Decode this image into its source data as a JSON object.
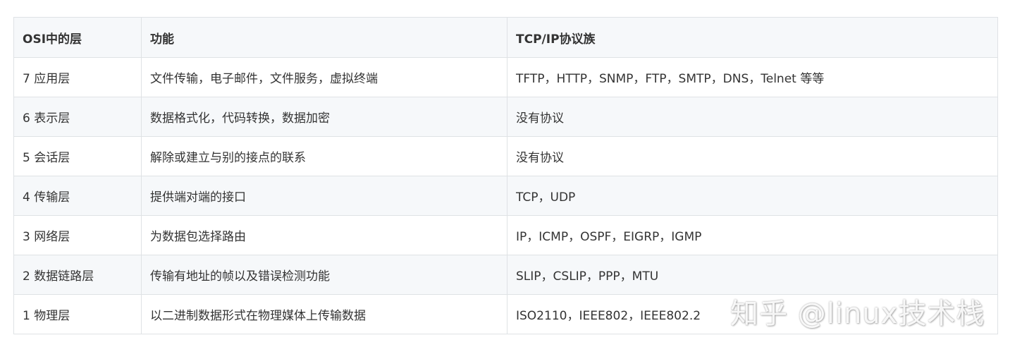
{
  "table": {
    "headers": [
      "OSI中的层",
      "功能",
      "TCP/IP协议族"
    ],
    "rows": [
      {
        "layer": "7 应用层",
        "function": "文件传输，电子邮件，文件服务，虚拟终端",
        "protocols": "TFTP，HTTP，SNMP，FTP，SMTP，DNS，Telnet 等等"
      },
      {
        "layer": "6 表示层",
        "function": "数据格式化，代码转换，数据加密",
        "protocols": "没有协议"
      },
      {
        "layer": "5 会话层",
        "function": "解除或建立与别的接点的联系",
        "protocols": "没有协议"
      },
      {
        "layer": "4 传输层",
        "function": "提供端对端的接口",
        "protocols": "TCP，UDP"
      },
      {
        "layer": "3 网络层",
        "function": "为数据包选择路由",
        "protocols": "IP，ICMP，OSPF，EIGRP，IGMP"
      },
      {
        "layer": "2 数据链路层",
        "function": "传输有地址的帧以及错误检测功能",
        "protocols": "SLIP，CSLIP，PPP，MTU"
      },
      {
        "layer": "1 物理层",
        "function": "以二进制数据形式在物理媒体上传输数据",
        "protocols": "ISO2110，IEEE802，IEEE802.2"
      }
    ]
  },
  "watermark": "知乎 @linux技术栈",
  "colors": {
    "border": "#dfe2e5",
    "stripe": "#f6f8fa",
    "text": "#333333"
  }
}
